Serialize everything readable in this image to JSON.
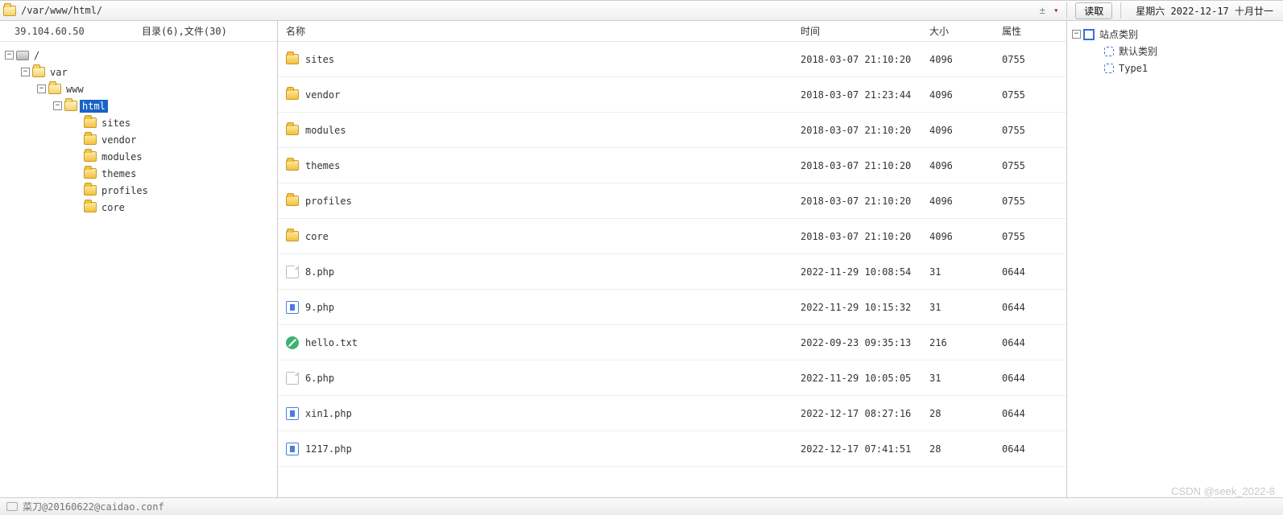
{
  "toolbar": {
    "path": "/var/www/html/",
    "read_button": "读取",
    "date_info": "星期六 2022-12-17 十月廿一"
  },
  "left": {
    "ip": "39.104.60.50",
    "counts": "目录(6),文件(30)",
    "tree": {
      "root": "/",
      "var": "var",
      "www": "www",
      "html": "html",
      "children": [
        "sites",
        "vendor",
        "modules",
        "themes",
        "profiles",
        "core"
      ]
    }
  },
  "list": {
    "headers": {
      "name": "名称",
      "time": "时间",
      "size": "大小",
      "attr": "属性"
    },
    "rows": [
      {
        "icon": "folder",
        "name": "sites",
        "time": "2018-03-07 21:10:20",
        "size": "4096",
        "attr": "0755"
      },
      {
        "icon": "folder",
        "name": "vendor",
        "time": "2018-03-07 21:23:44",
        "size": "4096",
        "attr": "0755"
      },
      {
        "icon": "folder",
        "name": "modules",
        "time": "2018-03-07 21:10:20",
        "size": "4096",
        "attr": "0755"
      },
      {
        "icon": "folder",
        "name": "themes",
        "time": "2018-03-07 21:10:20",
        "size": "4096",
        "attr": "0755"
      },
      {
        "icon": "folder",
        "name": "profiles",
        "time": "2018-03-07 21:10:20",
        "size": "4096",
        "attr": "0755"
      },
      {
        "icon": "folder",
        "name": "core",
        "time": "2018-03-07 21:10:20",
        "size": "4096",
        "attr": "0755"
      },
      {
        "icon": "file",
        "name": "8.php",
        "time": "2022-11-29 10:08:54",
        "size": "31",
        "attr": "0644"
      },
      {
        "icon": "blue",
        "name": "9.php",
        "time": "2022-11-29 10:15:32",
        "size": "31",
        "attr": "0644"
      },
      {
        "icon": "green",
        "name": "hello.txt",
        "time": "2022-09-23 09:35:13",
        "size": "216",
        "attr": "0644"
      },
      {
        "icon": "file",
        "name": "6.php",
        "time": "2022-11-29 10:05:05",
        "size": "31",
        "attr": "0644"
      },
      {
        "icon": "blue",
        "name": "xin1.php",
        "time": "2022-12-17 08:27:16",
        "size": "28",
        "attr": "0644"
      },
      {
        "icon": "blue",
        "name": "1217.php",
        "time": "2022-12-17 07:41:51",
        "size": "28",
        "attr": "0644"
      }
    ]
  },
  "right": {
    "root": "站点类别",
    "items": [
      "默认类别",
      "Type1"
    ]
  },
  "status": "菜刀@20160622@caidao.conf",
  "watermark": "CSDN @seek_2022-8"
}
